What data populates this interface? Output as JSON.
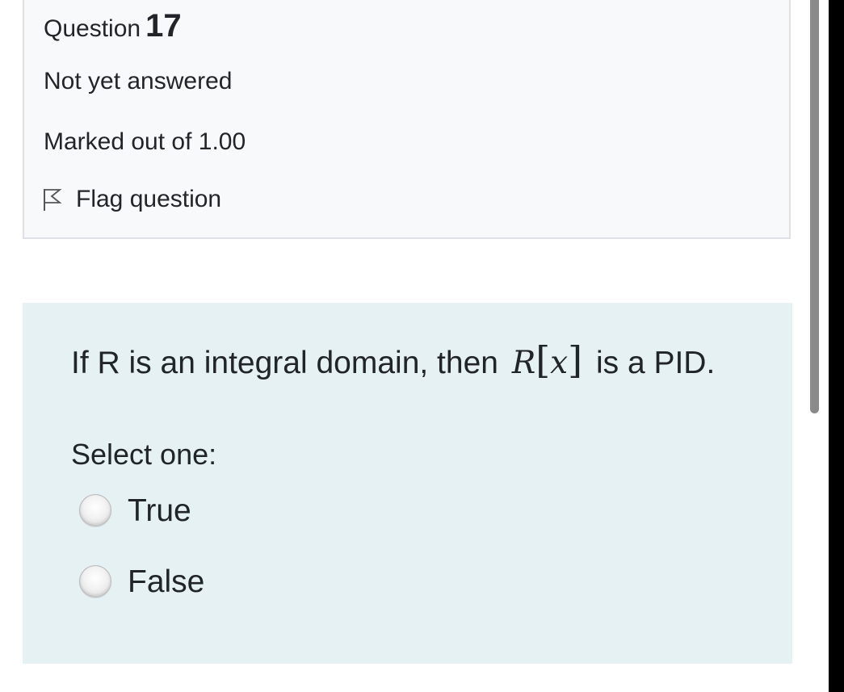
{
  "info": {
    "question_prefix": "Question",
    "question_number": "17",
    "state": "Not yet answered",
    "grade": "Marked out of 1.00",
    "flag_label": "Flag question",
    "flag_icon": "flag-outline-icon"
  },
  "question": {
    "text_before": "If R is an integral domain, then",
    "math_var": "R",
    "math_open": "[",
    "math_arg": "x",
    "math_close": "]",
    "text_after": "is a PID.",
    "prompt": "Select one:",
    "options": [
      {
        "label": "True",
        "selected": false
      },
      {
        "label": "False",
        "selected": false
      }
    ]
  },
  "colors": {
    "info_background": "#f8f9fa",
    "content_background": "#e6f1f3",
    "text": "#212529",
    "scrollbar_thumb": "#8a8a8a"
  }
}
